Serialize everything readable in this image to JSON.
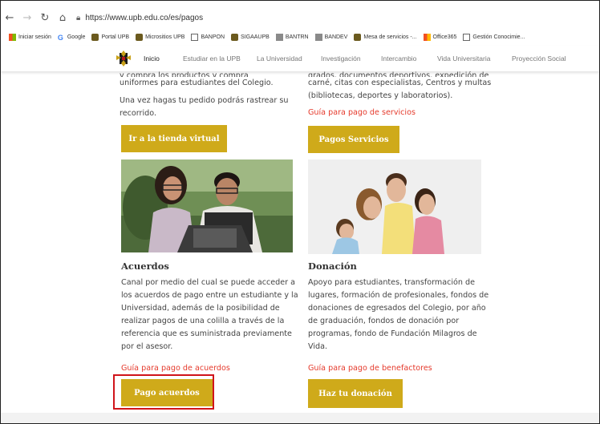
{
  "browser": {
    "url": "https://www.upb.edu.co/es/pagos",
    "bookmarks": [
      {
        "label": "Iniciar sesión",
        "icon": "microsoft-icon"
      },
      {
        "label": "Google",
        "icon": "google-icon"
      },
      {
        "label": "Portal UPB",
        "icon": "upb-icon"
      },
      {
        "label": "Micrositios UPB",
        "icon": "upb-icon"
      },
      {
        "label": "BANPON",
        "icon": "page-icon"
      },
      {
        "label": "SIGAAUPB",
        "icon": "upb-icon"
      },
      {
        "label": "BANTRN",
        "icon": "bank-icon"
      },
      {
        "label": "BANDEV",
        "icon": "bank-icon"
      },
      {
        "label": "Mesa de servicios -...",
        "icon": "upb-icon"
      },
      {
        "label": "Office365",
        "icon": "office-icon"
      },
      {
        "label": "Gestión Conocimie...",
        "icon": "page-icon"
      }
    ]
  },
  "site_nav": {
    "items": [
      "Inicio",
      "Estudiar en la UPB",
      "La Universidad",
      "Investigación",
      "Intercambio",
      "Vida Universitaria",
      "Proyección Social"
    ]
  },
  "left_top": {
    "lines": [
      "uniformes para estudiantes del Colegio.",
      "Una vez hagas tu pedido podrás rastrear su",
      "recorrido."
    ],
    "cut_line": "y compra los productos y compra",
    "button": "Ir a la tienda virtual"
  },
  "right_top": {
    "cut_line": "grados, documentos deportivos, expedición de",
    "lines": [
      "carné, citas con especialistas, Centros y multas",
      "(bibliotecas, deportes y laboratorios)."
    ],
    "link": "Guía para pago de servicios",
    "button": "Pagos Servicios"
  },
  "acuerdos": {
    "title": "Acuerdos",
    "lines": [
      "Canal por medio del cual se puede acceder a",
      "los acuerdos de pago entre un estudiante y la",
      "Universidad, además de la posibilidad de",
      "realizar pagos de una colilla a través de la",
      "referencia que es suministrada previamente",
      "por el asesor."
    ],
    "link": "Guía para pago de acuerdos",
    "button": "Pago acuerdos"
  },
  "donacion": {
    "title": "Donación",
    "lines": [
      "Apoyo para estudiantes, transformación de",
      "lugares, formación de profesionales, fondos de",
      "donaciones de egresados del Colegio, por año",
      "de graduación, fondos de donación por",
      "programas, fondo de Fundación Milagros de",
      "Vida."
    ],
    "link": "Guía para pago de benefactores",
    "button": "Haz tu donación"
  },
  "colors": {
    "accent": "#cfaa1a",
    "link": "#e53a2c",
    "highlight": "#d0141b"
  }
}
